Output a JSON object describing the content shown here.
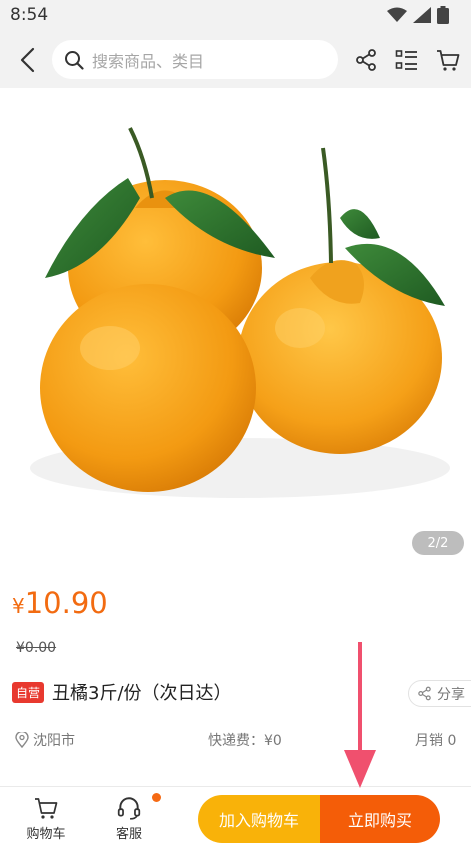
{
  "status_bar": {
    "time": "8:54"
  },
  "header": {
    "search_placeholder": "搜索商品、类目",
    "icons": [
      "back-icon",
      "search-icon",
      "share-icon",
      "list-menu-icon",
      "cart-icon"
    ]
  },
  "gallery": {
    "counter": "2/2"
  },
  "product": {
    "currency": "¥",
    "price": "10.90",
    "original_price": "¥0.00",
    "badge": "自营",
    "title": "丑橘3斤/份（次日达）",
    "share_label": "分享",
    "location": "沈阳市",
    "shipping": "快递费：¥0",
    "monthly_sales": "月销 0"
  },
  "bottom_bar": {
    "cart_label": "购物车",
    "service_label": "客服",
    "add_to_cart": "加入购物车",
    "buy_now": "立即购买"
  },
  "colors": {
    "price": "#f26b11",
    "add_to_cart": "#f9b209",
    "buy_now": "#f45d08",
    "badge": "#e8392f",
    "annotation_arrow": "#f0506e"
  }
}
